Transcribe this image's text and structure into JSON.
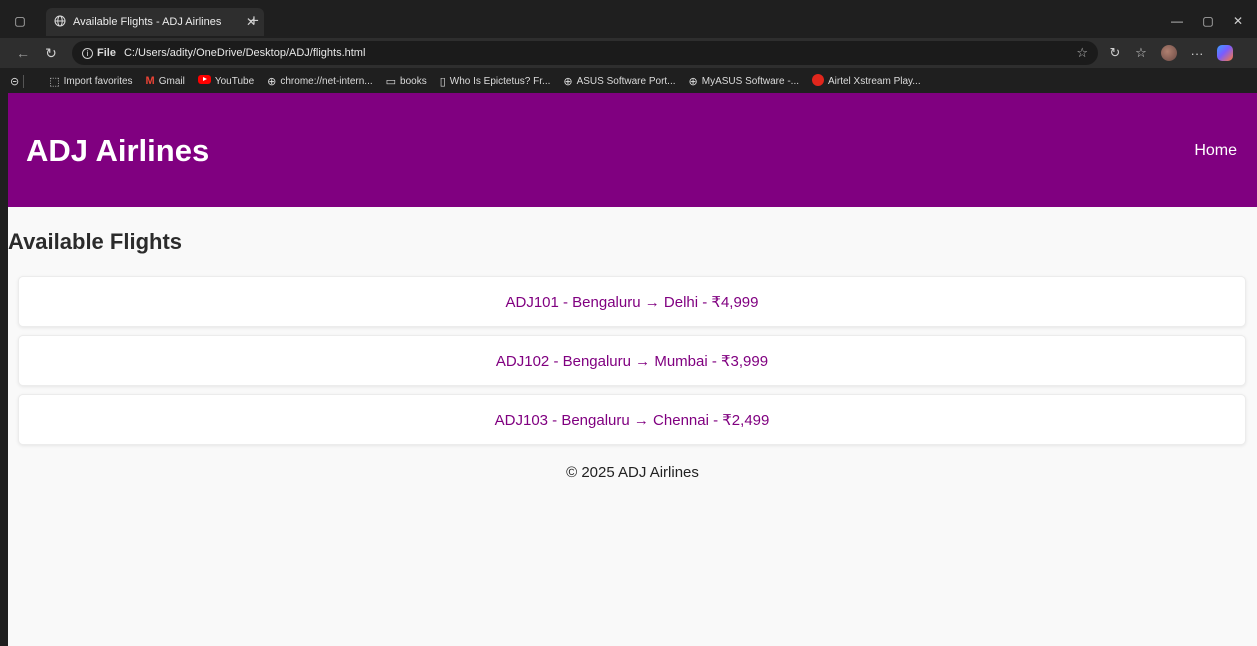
{
  "browser": {
    "tab_title": "Available Flights - ADJ Airlines",
    "url_scheme": "File",
    "url": "C:/Users/adity/OneDrive/Desktop/ADJ/flights.html",
    "bookmarks": [
      {
        "label": "Import favorites",
        "icon": "import-icon"
      },
      {
        "label": "Gmail",
        "icon": "gmail-icon"
      },
      {
        "label": "YouTube",
        "icon": "youtube-icon"
      },
      {
        "label": "chrome://net-intern...",
        "icon": "globe-icon"
      },
      {
        "label": "books",
        "icon": "folder-icon"
      },
      {
        "label": "Who Is Epictetus? Fr...",
        "icon": "page-icon"
      },
      {
        "label": "ASUS Software Port...",
        "icon": "globe-icon"
      },
      {
        "label": "MyASUS Software -...",
        "icon": "globe-icon"
      },
      {
        "label": "Airtel Xstream Play...",
        "icon": "airtel-icon"
      }
    ]
  },
  "site": {
    "brand": "ADJ Airlines",
    "nav_home": "Home",
    "colors": {
      "header_bg": "#800080",
      "link": "#800080",
      "page_bg": "#f9f9f9"
    }
  },
  "main": {
    "heading": "Available Flights",
    "flights": [
      {
        "label": "ADJ101 - Bengaluru → Delhi - ₹4,999"
      },
      {
        "label": "ADJ102 - Bengaluru → Mumbai - ₹3,999"
      },
      {
        "label": "ADJ103 - Bengaluru → Chennai - ₹2,499"
      }
    ]
  },
  "footer": {
    "text": "© 2025 ADJ Airlines"
  }
}
